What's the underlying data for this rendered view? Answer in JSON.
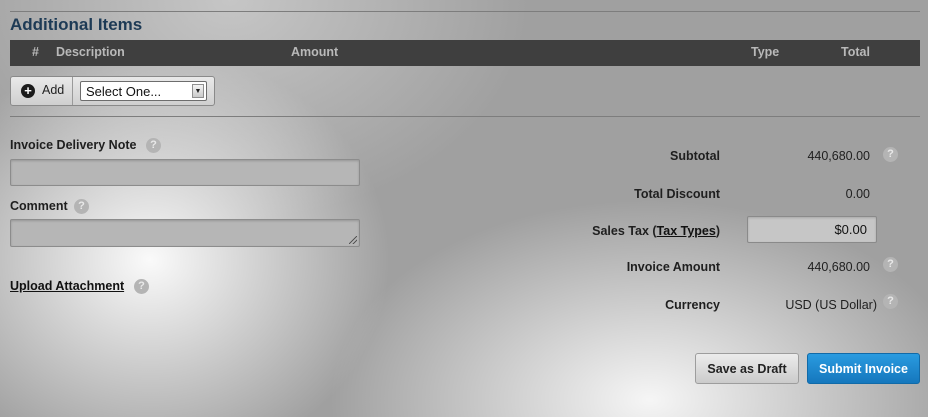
{
  "section": {
    "title": "Additional Items"
  },
  "table": {
    "columns": {
      "number": "#",
      "description": "Description",
      "amount": "Amount",
      "type": "Type",
      "total": "Total"
    }
  },
  "add_controls": {
    "add_label": "Add",
    "select_value": "Select One..."
  },
  "fields": {
    "delivery_note_label": "Invoice Delivery Note",
    "delivery_note_value": "",
    "comment_label": "Comment",
    "comment_value": "",
    "upload_label": "Upload Attachment",
    "help_glyph": "?"
  },
  "summary": {
    "subtotal_label": "Subtotal",
    "subtotal_value": "440,680.00",
    "discount_label": "Total Discount",
    "discount_value": "0.00",
    "sales_tax_prefix": "Sales Tax (",
    "sales_tax_link": "Tax Types",
    "sales_tax_suffix": ")",
    "sales_tax_value": "$0.00",
    "invoice_amount_label": "Invoice Amount",
    "invoice_amount_value": "440,680.00",
    "currency_label": "Currency",
    "currency_value": "USD (US Dollar)"
  },
  "actions": {
    "save_draft": "Save as Draft",
    "submit": "Submit Invoice"
  },
  "colors": {
    "title": "#1d3a55",
    "header_bar": "#3f3f3f",
    "submit_button": "#1b86cf"
  },
  "icons": [
    "plus-circle-icon",
    "dropdown-arrow-icon",
    "help-icon",
    "resize-grip-icon"
  ]
}
